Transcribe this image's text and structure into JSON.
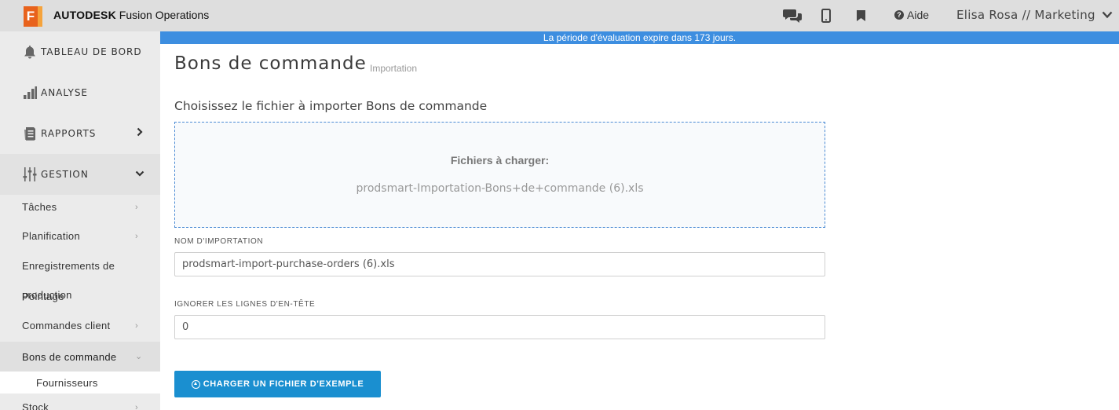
{
  "app": {
    "logo_letter": "F",
    "brand_strong": "AUTODESK",
    "brand_rest": "Fusion Operations"
  },
  "topbar": {
    "icons": [
      "chat-icon",
      "mobile-icon",
      "bookmark-icon",
      "question-circle-icon",
      "chevron-down-icon"
    ],
    "help_label": "Aide",
    "user_label": "Elisa Rosa // Marketing"
  },
  "banner": {
    "text": "La période d'évaluation expire dans 173 jours."
  },
  "sidebar": {
    "items": [
      {
        "label": "TABLEAU DE BORD",
        "icon": "bell-icon"
      },
      {
        "label": "ANALYSE",
        "icon": "bar-chart-icon"
      },
      {
        "label": "RAPPORTS",
        "icon": "report-icon"
      },
      {
        "label": "GESTION",
        "icon": "sliders-icon"
      }
    ],
    "sub_items": [
      {
        "label": "Tâches"
      },
      {
        "label": "Planification"
      },
      {
        "label": "Enregistrements de"
      },
      {
        "label": "production"
      },
      {
        "label": "Pointage"
      },
      {
        "label": "Commandes client"
      },
      {
        "label": "Bons de commande"
      },
      {
        "label": "Fournisseurs"
      },
      {
        "label": "Stock"
      }
    ]
  },
  "main": {
    "title": "Bons de commande",
    "subtitle": "Importation",
    "choose_label": "Choisissez le fichier à importer Bons de commande",
    "dropzone": {
      "title": "Fichiers à charger:",
      "file_name": "prodsmart-Importation-Bons+de+commande (6).xls"
    },
    "import_name": {
      "label": "NOM D'IMPORTATION",
      "value": "prodsmart-import-purchase-orders (6).xls"
    },
    "ignore_header": {
      "label": "IGNORER LES LIGNES D'EN-TÊTE",
      "value": "0"
    },
    "sample_button_label": "CHARGER UN FICHIER D'EXEMPLE"
  },
  "colors": {
    "logo": "#e8621c",
    "banner": "#3d8ee0",
    "button": "#1a8fd0",
    "dropzone_border": "#4a8ad4",
    "sidebar_bg": "#ebebeb",
    "topbar_bg": "#dedede"
  }
}
